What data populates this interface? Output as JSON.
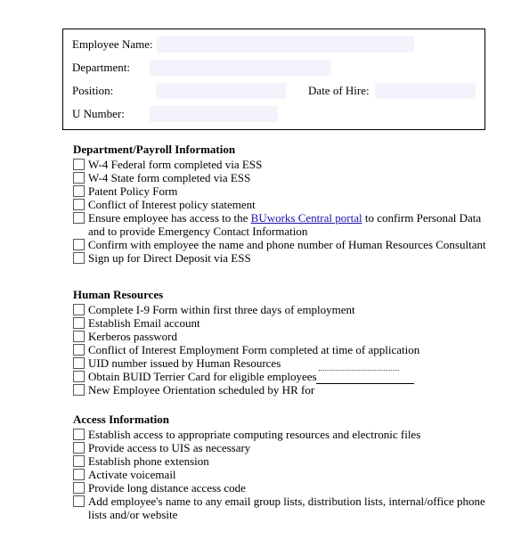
{
  "header": {
    "employee_name_label": "Employee Name:",
    "employee_name_value": "",
    "department_label": "Department:",
    "department_value": "",
    "position_label": "Position:",
    "position_value": "",
    "date_of_hire_label": "Date of Hire:",
    "date_of_hire_value": "",
    "u_number_label": "U Number:",
    "u_number_value": ""
  },
  "sections": {
    "payroll": {
      "title": "Department/Payroll Information",
      "items": [
        "W-4 Federal form completed via ESS",
        "W-4 State form completed via ESS",
        "Patent Policy Form",
        "Conflict of Interest policy statement"
      ],
      "access_pre": "Ensure employee has access to the ",
      "access_link": "BUworks Central portal",
      "access_post": " to confirm Personal Data",
      "access_cont": "and to provide Emergency Contact Information",
      "items2": [
        "Confirm with employee the name and phone number of Human Resources Consultant",
        "Sign up for Direct Deposit via ESS"
      ]
    },
    "hr": {
      "title": "Human Resources",
      "items": [
        "Complete I-9 Form within first three days of employment",
        "Establish Email account",
        "Kerberos password",
        "Conflict of Interest Employment Form completed at time of application",
        "UID number issued by Human Resources",
        "Obtain BUID Terrier Card for eligible employees"
      ],
      "orientation_pre": "New Employee Orientation scheduled by HR for ",
      "orientation_value": ""
    },
    "access": {
      "title": "Access Information",
      "items": [
        "Establish access to appropriate computing resources and electronic files",
        "Provide access to UIS as necessary",
        "Establish phone extension",
        "Activate voicemail",
        "Provide long distance access code"
      ],
      "email_groups": "Add employee's name to any email group lists, distribution lists, internal/office phone",
      "email_groups_cont": "lists and/or website"
    }
  }
}
